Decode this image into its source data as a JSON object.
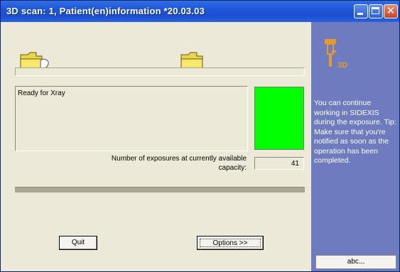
{
  "window": {
    "title": "3D scan: 1, Patient(en)information *20.03.03",
    "close_glyph": "✕"
  },
  "icons": {
    "folder_left": "folder-open-icon",
    "folder_right": "folder-icon",
    "logo": "3d-scanner-logo-icon"
  },
  "main": {
    "status_text": "Ready for Xray",
    "exposure_label_line1": "Number of exposures at currently available",
    "exposure_label_line2": "capacity:",
    "exposure_value": "41",
    "quit_label": "Quit",
    "options_label": "Options >>"
  },
  "sidepanel": {
    "message": "You can continue working in SIDEXIS during the exposure. Tip: Make sure that you're notified as soon as the operation has been completed.",
    "button_label": "abc...",
    "logo_text": "3D"
  },
  "colors": {
    "titlebar": "#1f56d8",
    "client_bg": "#ece9d8",
    "sidepanel_bg": "#6e7bbf",
    "ready_indicator": "#00ff00",
    "logo_accent": "#e59a2a"
  }
}
